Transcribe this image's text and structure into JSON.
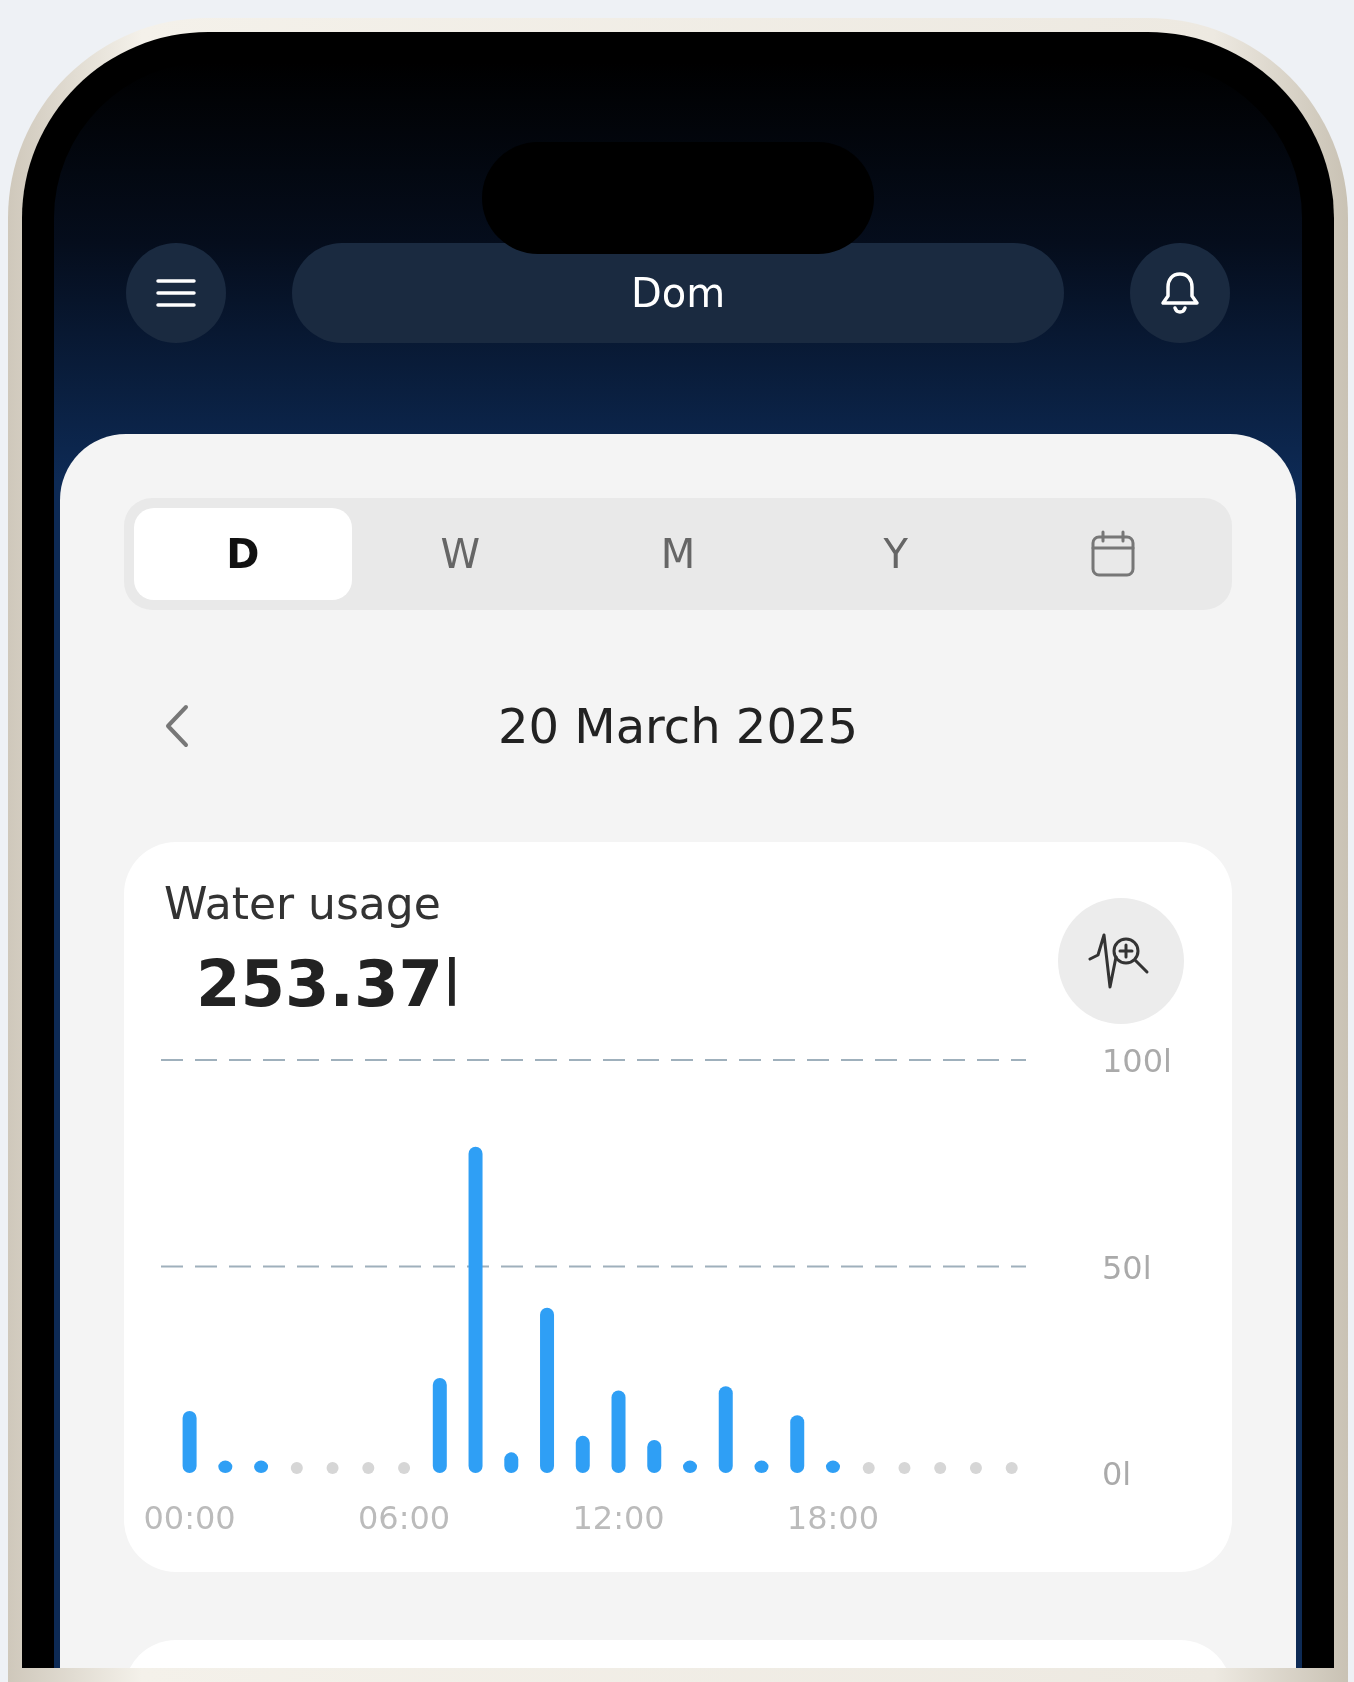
{
  "header": {
    "title": "Dom"
  },
  "tabs": [
    {
      "label": "D",
      "selected": true
    },
    {
      "label": "W",
      "selected": false
    },
    {
      "label": "M",
      "selected": false
    },
    {
      "label": "Y",
      "selected": false
    }
  ],
  "date": "20 March 2025",
  "usage_card": {
    "title": "Water usage",
    "total": "**253.37**l",
    "chart_data": {
      "type": "bar",
      "x": [
        0,
        1,
        2,
        3,
        4,
        5,
        6,
        7,
        8,
        9,
        10,
        11,
        12,
        13,
        14,
        15,
        16,
        17,
        18,
        19,
        20,
        21,
        22,
        23
      ],
      "values": [
        15,
        3,
        3,
        0,
        0,
        0,
        0,
        23,
        79,
        5,
        40,
        9,
        20,
        8,
        3,
        21,
        3,
        14,
        3,
        0,
        0,
        0,
        0,
        0
      ],
      "xlim": [
        -0.8,
        23.4
      ],
      "ylim": [
        0,
        100
      ],
      "xticks": [
        {
          "value": 0,
          "label": "00:00"
        },
        {
          "value": 6,
          "label": "06:00"
        },
        {
          "value": 12,
          "label": "12:00"
        },
        {
          "value": 18,
          "label": "18:00"
        }
      ],
      "yticks": [
        {
          "value": 0,
          "label": "0l"
        },
        {
          "value": 50,
          "label": "50l"
        },
        {
          "value": 100,
          "label": "100l"
        }
      ]
    }
  }
}
